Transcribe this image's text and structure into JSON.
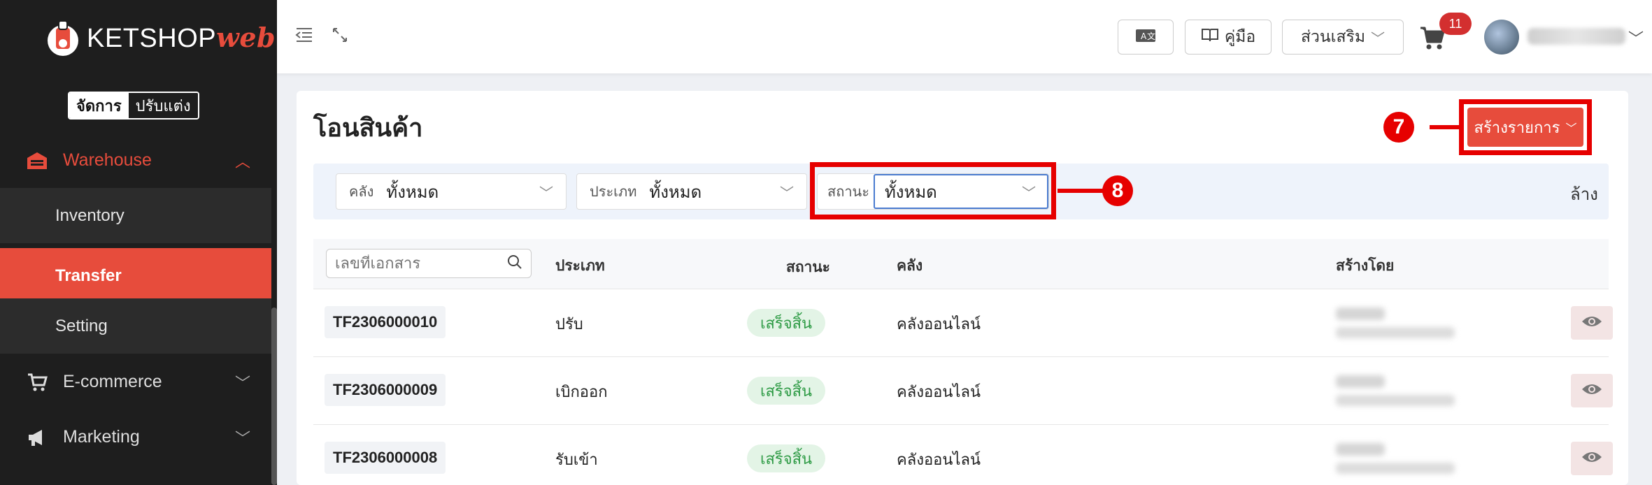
{
  "app": {
    "logo_main": "KETSHOP",
    "logo_accent": "web",
    "mode_active": "จัดการ",
    "mode_inactive": "ปรับแต่ง"
  },
  "sidebar": {
    "sections": [
      {
        "label": "Warehouse",
        "icon": "warehouse-icon",
        "expanded": true,
        "items": [
          {
            "label": "Inventory"
          },
          {
            "label": "Transfer",
            "active": true
          },
          {
            "label": "Setting"
          }
        ]
      },
      {
        "label": "E-commerce",
        "icon": "cart-icon",
        "expanded": false
      },
      {
        "label": "Marketing",
        "icon": "megaphone-icon",
        "expanded": false
      }
    ]
  },
  "header": {
    "manual_label": "คู่มือ",
    "extras_label": "ส่วนเสริม",
    "cart_count": "11"
  },
  "page": {
    "title": "โอนสินค้า",
    "create_button": "สร้างรายการ",
    "callouts": [
      "7",
      "8"
    ]
  },
  "filters": {
    "warehouse": {
      "label": "คลัง",
      "value": "ทั้งหมด"
    },
    "type": {
      "label": "ประเภท",
      "value": "ทั้งหมด"
    },
    "status": {
      "label": "สถานะ",
      "value": "ทั้งหมด"
    },
    "clear_label": "ล้าง"
  },
  "table": {
    "search_placeholder": "เลขที่เอกสาร",
    "columns": [
      "ประเภท",
      "สถานะ",
      "คลัง",
      "สร้างโดย"
    ],
    "rows": [
      {
        "doc_no": "TF2306000010",
        "type": "ปรับ",
        "status": "เสร็จสิ้น",
        "warehouse": "คลังออนไลน์"
      },
      {
        "doc_no": "TF2306000009",
        "type": "เบิกออก",
        "status": "เสร็จสิ้น",
        "warehouse": "คลังออนไลน์"
      },
      {
        "doc_no": "TF2306000008",
        "type": "รับเข้า",
        "status": "เสร็จสิ้น",
        "warehouse": "คลังออนไลน์"
      }
    ]
  },
  "colors": {
    "accent": "#e74c3c",
    "callout": "#e60000",
    "status_success": "#2e9b45"
  }
}
